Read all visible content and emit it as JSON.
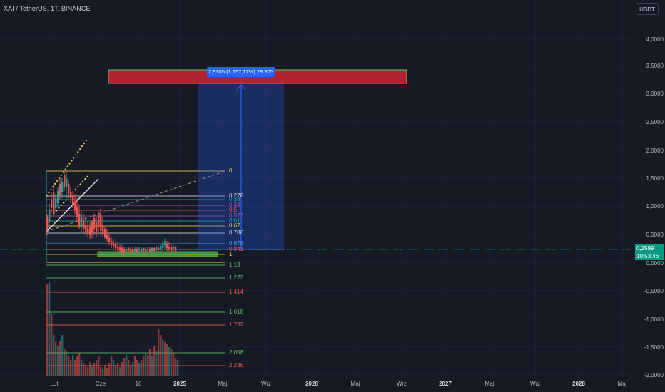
{
  "header": {
    "title": "XAI / TetherUS, 1T, BINANCE",
    "currency_button": "USDT"
  },
  "price_axis": {
    "ticks": [
      "4,0000",
      "3,5000",
      "3,0000",
      "2,5000",
      "2,0000",
      "1,5000",
      "1,0000",
      "0,5000",
      "0,0000",
      "-0,5000",
      "-1,0000",
      "-1,5000",
      "-2,0000"
    ],
    "current_price": "0,2599",
    "countdown": "10:53:46"
  },
  "time_axis": {
    "ticks": [
      {
        "label": "Lut",
        "bold": false
      },
      {
        "label": "Cze",
        "bold": false
      },
      {
        "label": "16",
        "bold": false
      },
      {
        "label": "2025",
        "bold": true
      },
      {
        "label": "Maj",
        "bold": false
      },
      {
        "label": "Wrz",
        "bold": false
      },
      {
        "label": "2026",
        "bold": true
      },
      {
        "label": "Maj",
        "bold": false
      },
      {
        "label": "Wrz",
        "bold": false
      },
      {
        "label": "2027",
        "bold": true
      },
      {
        "label": "Maj",
        "bold": false
      },
      {
        "label": "Wrz",
        "bold": false
      },
      {
        "label": "2028",
        "bold": true
      },
      {
        "label": "Maj",
        "bold": false
      }
    ]
  },
  "fibonacci": {
    "levels": [
      {
        "label": "0",
        "color": "#e6c84a"
      },
      {
        "label": "0,278",
        "color": "#d1d4dc"
      },
      {
        "label": "0,38",
        "color": "#26a69a"
      },
      {
        "label": "0,44",
        "color": "#ab47bc"
      },
      {
        "label": "0,5",
        "color": "#ef5350"
      },
      {
        "label": "0,577",
        "color": "#ab47bc"
      },
      {
        "label": "0,61",
        "color": "#26a69a"
      },
      {
        "label": "0,67",
        "color": "#e6c84a"
      },
      {
        "label": "0,786",
        "color": "#d1d4dc"
      },
      {
        "label": "0,878",
        "color": "#42a5f5"
      },
      {
        "label": "0,941",
        "color": "#ef5350"
      },
      {
        "label": "1",
        "color": "#e6c84a"
      },
      {
        "label": "1,13",
        "color": "#66bb6a"
      },
      {
        "label": "1,272",
        "color": "#66bb6a"
      },
      {
        "label": "1,414",
        "color": "#ef5350"
      },
      {
        "label": "1,618",
        "color": "#66bb6a"
      },
      {
        "label": "1,732",
        "color": "#ef5350"
      },
      {
        "label": "2,058",
        "color": "#66bb6a"
      },
      {
        "label": "2,236",
        "color": "#ef5350"
      }
    ]
  },
  "long_position": {
    "target_label": "2,9305 (1 157,17%) 29 305"
  },
  "colors": {
    "background": "#161a25",
    "up": "#26a69a",
    "down": "#ef5350",
    "target_zone": "#b2222f",
    "projection": "#2962ff",
    "accent_badge": "#089981"
  }
}
